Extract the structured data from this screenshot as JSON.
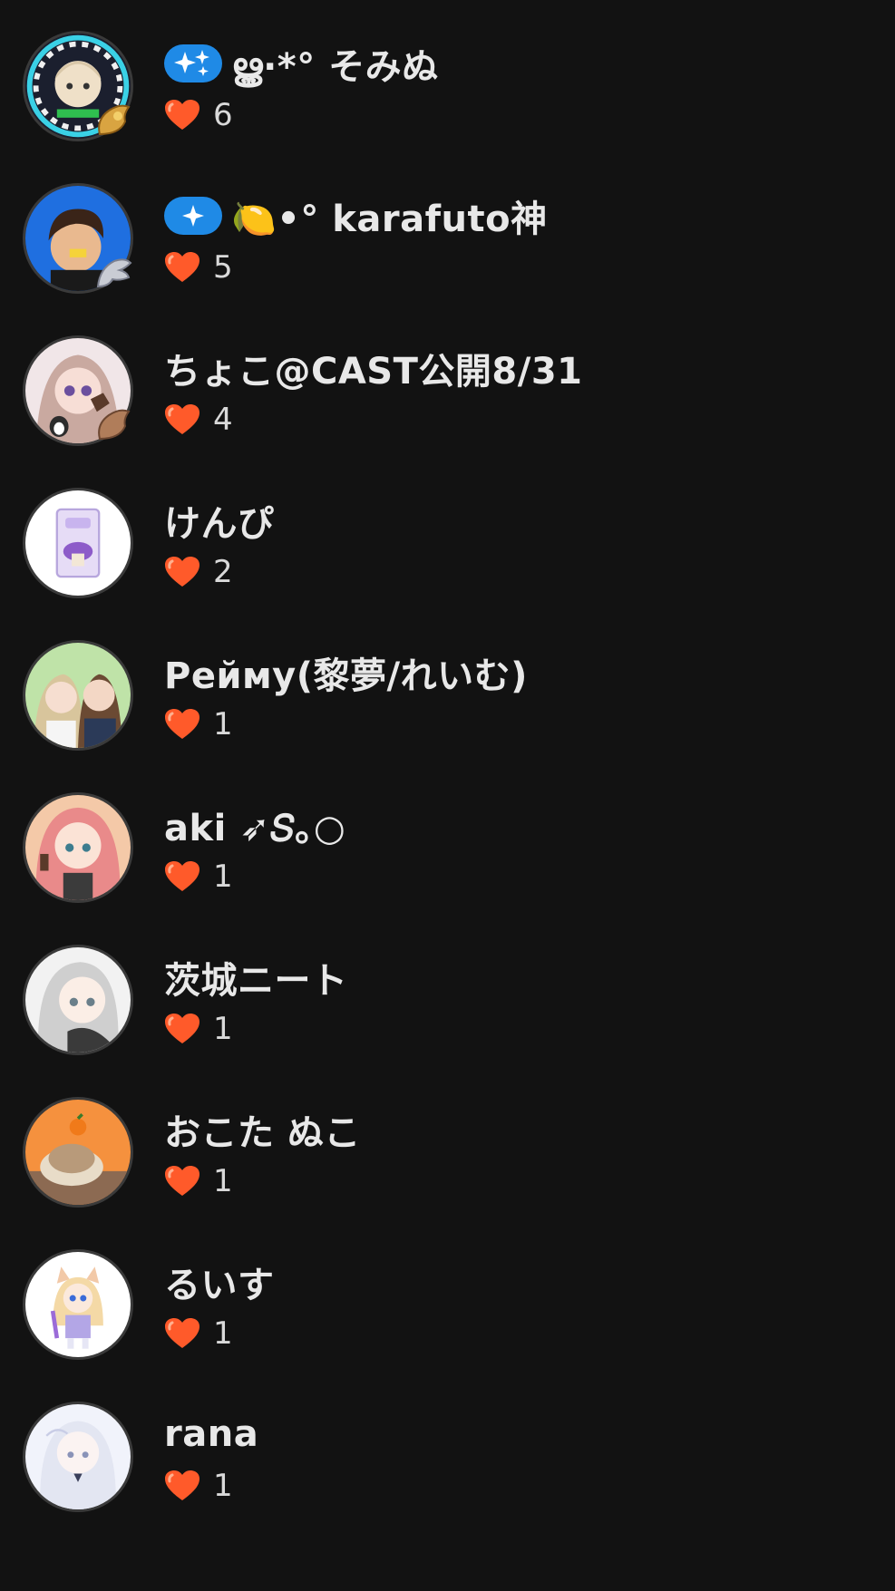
{
  "colors": {
    "background": "#121212",
    "name_text": "#e8e8e8",
    "count_text": "#d9d9d9",
    "badge": "#1f8ae6",
    "heart": "#ff5a2a"
  },
  "users": [
    {
      "name": "ൠ·*° そみぬ",
      "likes": "6",
      "badge": "sparkles-badge",
      "frame": "gold-frame"
    },
    {
      "name": "🍋•° karafuto神",
      "likes": "5",
      "badge": "sparkle-badge",
      "frame": "silver-wing-frame"
    },
    {
      "name": "ちょこ@CAST公開8/31",
      "likes": "4",
      "badge": "",
      "frame": "bronze-frame"
    },
    {
      "name": "けんぴ",
      "likes": "2",
      "badge": "",
      "frame": ""
    },
    {
      "name": "Рейму(黎夢/れいむ)",
      "likes": "1",
      "badge": "",
      "frame": ""
    },
    {
      "name": "aki ➶𝑆｡○",
      "likes": "1",
      "badge": "",
      "frame": ""
    },
    {
      "name": "茨城ニート",
      "likes": "1",
      "badge": "",
      "frame": ""
    },
    {
      "name": "おこた ぬこ",
      "likes": "1",
      "badge": "",
      "frame": ""
    },
    {
      "name": "るいす",
      "likes": "1",
      "badge": "",
      "frame": ""
    },
    {
      "name": "rana",
      "likes": "1",
      "badge": "",
      "frame": ""
    }
  ]
}
